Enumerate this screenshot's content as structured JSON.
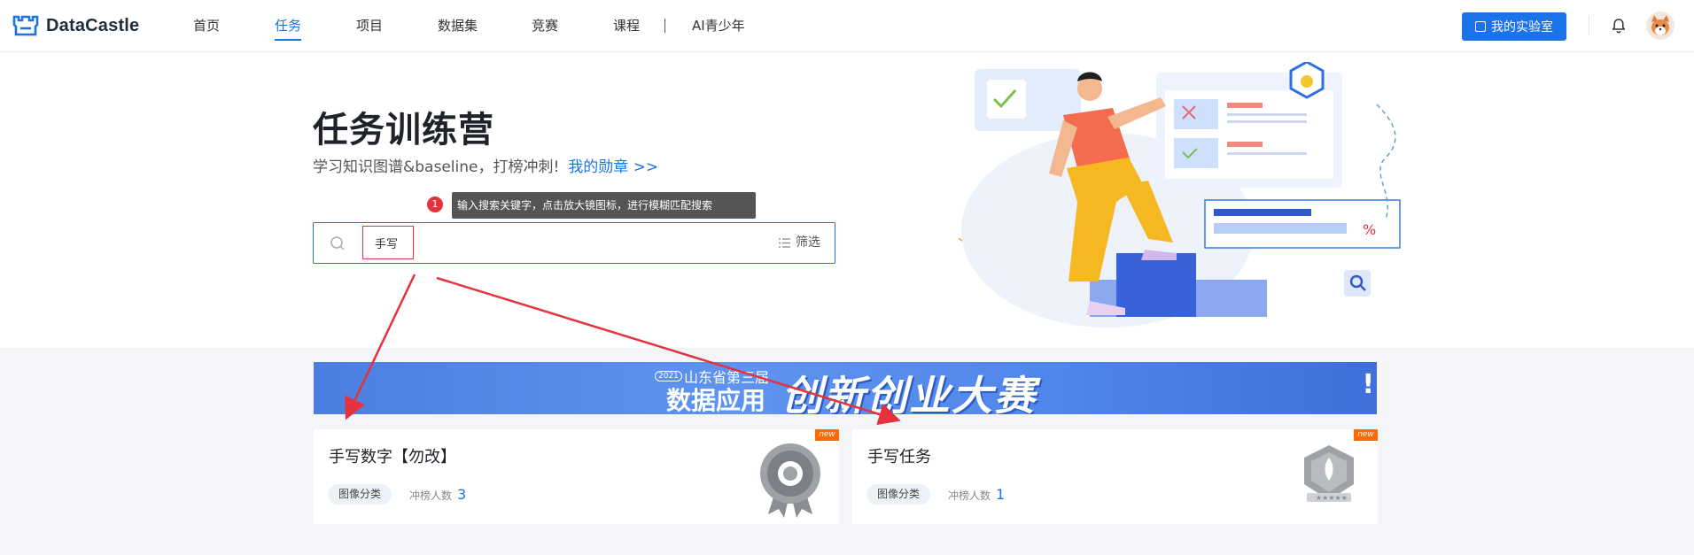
{
  "header": {
    "brand": "DataCastle",
    "nav": [
      {
        "label": "首页",
        "active": false
      },
      {
        "label": "任务",
        "active": true
      },
      {
        "label": "项目",
        "active": false
      },
      {
        "label": "数据集",
        "active": false
      },
      {
        "label": "竞赛",
        "active": false
      },
      {
        "label": "课程",
        "active": false
      },
      {
        "label": "AI青少年",
        "active": false
      }
    ],
    "lab_button": "我的实验室"
  },
  "hero": {
    "title": "任务训练营",
    "subtitle": "学习知识图谱&baseline，打榜冲刺!",
    "medal_link": "我的勋章",
    "medal_arrow": ">>"
  },
  "annotation": {
    "step": "1",
    "tooltip": "输入搜索关键字，点击放大镜图标，进行模糊匹配搜索"
  },
  "search": {
    "value": "手写",
    "placeholder": "",
    "filter_label": "筛选"
  },
  "banner": {
    "year_badge": "2021",
    "small_text": "山东省第三届",
    "mid_text": "数据应用",
    "big_text": "创新创业大赛",
    "exclaim": "!"
  },
  "cards": [
    {
      "title": "手写数字【勿改】",
      "tag": "图像分类",
      "rank_label": "冲榜人数",
      "rank_count": "3",
      "new_label": "new",
      "badge_icon": "gear-medal-icon"
    },
    {
      "title": "手写任务",
      "tag": "图像分类",
      "rank_label": "冲榜人数",
      "rank_count": "1",
      "new_label": "new",
      "badge_icon": "rocket-medal-icon"
    }
  ],
  "colors": {
    "accent": "#1a73e8",
    "annotation_red": "#e5323d",
    "new_tag": "#ff6a00"
  }
}
